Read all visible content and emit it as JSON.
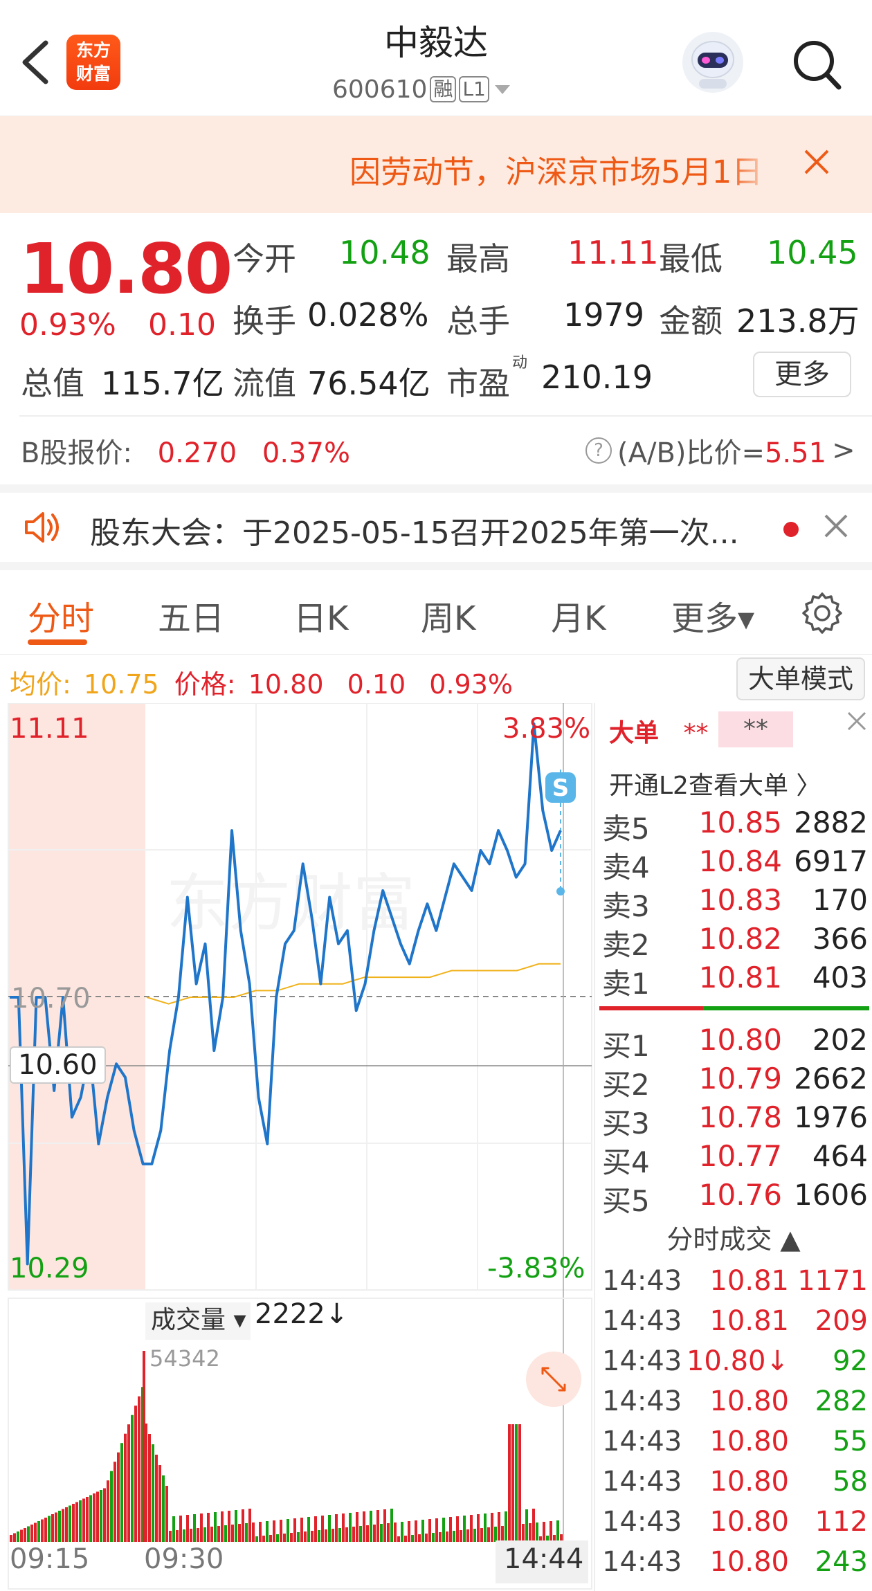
{
  "header": {
    "logo_line1": "东方",
    "logo_line2": "财富",
    "stock_name": "中毅达",
    "stock_code": "600610",
    "tag_margin": "融",
    "tag_level": "L1"
  },
  "notice": {
    "text": "因劳动节，沪深京市场5月1日"
  },
  "quote": {
    "price": "10.80",
    "change_pct": "0.93%",
    "change_amt": "0.10",
    "open_label": "今开",
    "open": "10.48",
    "high_label": "最高",
    "high": "11.11",
    "low_label": "最低",
    "low": "10.45",
    "turnover_label": "换手",
    "turnover": "0.028%",
    "volume_label": "总手",
    "volume": "1979",
    "amount_label": "金额",
    "amount": "213.8万",
    "mktcap_label": "总值",
    "mktcap": "115.7亿",
    "float_label": "流值",
    "float": "76.54亿",
    "pe_label": "市盈",
    "pe_sup": "动",
    "pe": "210.19",
    "more_label": "更多"
  },
  "bshare": {
    "label": "B股报价:",
    "price": "0.270",
    "pct": "0.37%",
    "ratio_label": "(A/B)比价=",
    "ratio": "5.51",
    "ratio_arrow": ">"
  },
  "meeting": {
    "text": "股东大会：于2025-05-15召开2025年第一次..."
  },
  "tabs": [
    {
      "label": "分时"
    },
    {
      "label": "五日"
    },
    {
      "label": "日K"
    },
    {
      "label": "周K"
    },
    {
      "label": "月K"
    },
    {
      "label": "更多▾"
    }
  ],
  "info": {
    "avg_label": "均价:",
    "avg": "10.75",
    "price_label": "价格:",
    "price": "10.80",
    "chg": "0.10",
    "pct": "0.93%",
    "big_order_mode": "大单模式"
  },
  "chart_labels": {
    "y_top": "11.11",
    "y_top_pct": "3.83%",
    "y_bottom": "10.29",
    "y_bottom_pct": "-3.83%",
    "ref_price": "10.70",
    "crosshair_price": "10.60",
    "vol_selector": "成交量 ▾",
    "vol_value": "2222↓",
    "vol_max": "54342",
    "x_start": "09:15",
    "x_mid": "09:30",
    "x_cursor": "14:44",
    "watermark": "东方财富"
  },
  "chart_data": {
    "type": "line",
    "ylim": [
      10.29,
      11.11
    ],
    "ref_price": 10.7,
    "price_series": [
      10.7,
      10.7,
      10.3,
      10.7,
      10.7,
      10.56,
      10.7,
      10.52,
      10.55,
      10.62,
      10.48,
      10.55,
      10.6,
      10.58,
      10.5,
      10.45,
      10.45,
      10.5,
      10.62,
      10.7,
      10.85,
      10.72,
      10.78,
      10.62,
      10.7,
      10.95,
      10.8,
      10.72,
      10.55,
      10.48,
      10.7,
      10.78,
      10.8,
      10.9,
      10.82,
      10.72,
      10.85,
      10.78,
      10.8,
      10.68,
      10.72,
      10.8,
      10.86,
      10.82,
      10.78,
      10.75,
      10.8,
      10.84,
      10.8,
      10.85,
      10.9,
      10.88,
      10.86,
      10.92,
      10.9,
      10.95,
      10.92,
      10.88,
      10.9,
      11.11,
      10.98,
      10.92,
      10.95
    ],
    "avg_series": [
      10.7,
      10.69,
      10.7,
      10.7,
      10.7,
      10.71,
      10.71,
      10.72,
      10.72,
      10.72,
      10.73,
      10.73,
      10.73,
      10.73,
      10.74,
      10.74,
      10.74,
      10.74,
      10.75,
      10.75
    ],
    "volume_series": [],
    "x_ticks": [
      "09:15",
      "09:30",
      "14:44"
    ]
  },
  "big_orders": {
    "title": "大单",
    "stars": "**",
    "pill": "**",
    "l2_link": "开通L2查看大单 〉"
  },
  "order_book": {
    "asks": [
      {
        "label": "卖5",
        "price": "10.85",
        "vol": "2882"
      },
      {
        "label": "卖4",
        "price": "10.84",
        "vol": "6917"
      },
      {
        "label": "卖3",
        "price": "10.83",
        "vol": "170"
      },
      {
        "label": "卖2",
        "price": "10.82",
        "vol": "366"
      },
      {
        "label": "卖1",
        "price": "10.81",
        "vol": "403"
      }
    ],
    "bids": [
      {
        "label": "买1",
        "price": "10.80",
        "vol": "202"
      },
      {
        "label": "买2",
        "price": "10.79",
        "vol": "2662"
      },
      {
        "label": "买3",
        "price": "10.78",
        "vol": "1976"
      },
      {
        "label": "买4",
        "price": "10.77",
        "vol": "464"
      },
      {
        "label": "买5",
        "price": "10.76",
        "vol": "1606"
      }
    ]
  },
  "trades": {
    "header": "分时成交 ▲",
    "rows": [
      {
        "time": "14:43",
        "price": "10.81",
        "vol": "1171",
        "dir": "up"
      },
      {
        "time": "14:43",
        "price": "10.81",
        "vol": "209",
        "dir": "up"
      },
      {
        "time": "14:43",
        "price": "10.80↓",
        "vol": "92",
        "dir": "down"
      },
      {
        "time": "14:43",
        "price": "10.80",
        "vol": "282",
        "dir": "down"
      },
      {
        "time": "14:43",
        "price": "10.80",
        "vol": "55",
        "dir": "down"
      },
      {
        "time": "14:43",
        "price": "10.80",
        "vol": "58",
        "dir": "down"
      },
      {
        "time": "14:43",
        "price": "10.80",
        "vol": "112",
        "dir": "up"
      },
      {
        "time": "14:43",
        "price": "10.80",
        "vol": "243",
        "dir": "down"
      }
    ]
  },
  "colors": {
    "up": "#e0222b",
    "down": "#13a113",
    "accent": "#ee5a16",
    "price_line": "#1f75c9",
    "avg_line": "#f0b21b"
  }
}
